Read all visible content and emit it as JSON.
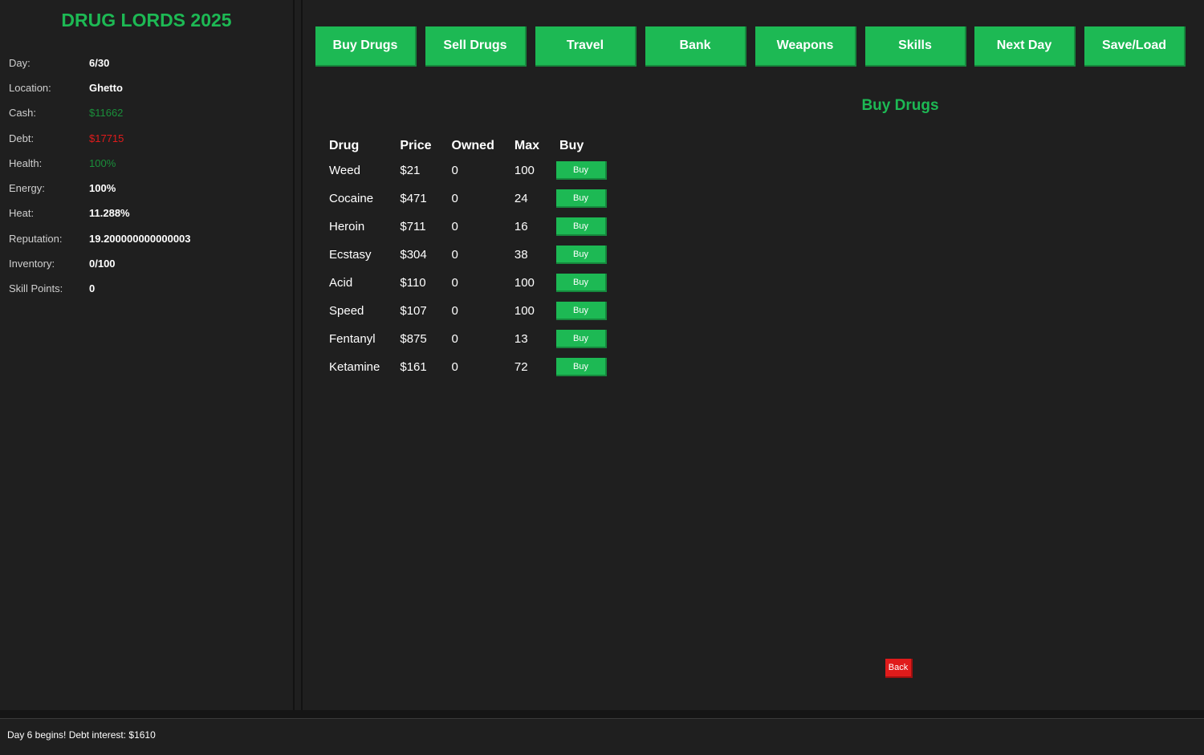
{
  "app": {
    "title": "DRUG LORDS 2025",
    "accent_color": "#1db954",
    "danger_color": "#e01b1b"
  },
  "stats": [
    {
      "label": "Day:",
      "value": "6/30"
    },
    {
      "label": "Location:",
      "value": "Ghetto"
    },
    {
      "label": "Cash:",
      "value": "$11662"
    },
    {
      "label": "Debt:",
      "value": "$17715"
    },
    {
      "label": "Health:",
      "value": "100%"
    },
    {
      "label": "Energy:",
      "value": "100%"
    },
    {
      "label": "Heat:",
      "value": "11.288%"
    },
    {
      "label": "Reputation:",
      "value": "19.200000000000003"
    },
    {
      "label": "Inventory:",
      "value": "0/100"
    },
    {
      "label": "Skill Points:",
      "value": "0"
    }
  ],
  "nav": {
    "buttons": [
      "Buy Drugs",
      "Sell Drugs",
      "Travel",
      "Bank",
      "Weapons",
      "Skills",
      "Next Day",
      "Save/Load"
    ]
  },
  "section": {
    "title": "Buy Drugs"
  },
  "table": {
    "headers": [
      "Drug",
      "Price",
      "Owned",
      "Max",
      "Buy"
    ],
    "rows": [
      {
        "drug": "Weed",
        "price": "$21",
        "owned": "0",
        "max": "100",
        "action": "Buy"
      },
      {
        "drug": "Cocaine",
        "price": "$471",
        "owned": "0",
        "max": "24",
        "action": "Buy"
      },
      {
        "drug": "Heroin",
        "price": "$711",
        "owned": "0",
        "max": "16",
        "action": "Buy"
      },
      {
        "drug": "Ecstasy",
        "price": "$304",
        "owned": "0",
        "max": "38",
        "action": "Buy"
      },
      {
        "drug": "Acid",
        "price": "$110",
        "owned": "0",
        "max": "100",
        "action": "Buy"
      },
      {
        "drug": "Speed",
        "price": "$107",
        "owned": "0",
        "max": "100",
        "action": "Buy"
      },
      {
        "drug": "Fentanyl",
        "price": "$875",
        "owned": "0",
        "max": "13",
        "action": "Buy"
      },
      {
        "drug": "Ketamine",
        "price": "$161",
        "owned": "0",
        "max": "72",
        "action": "Buy"
      }
    ]
  },
  "back_label": "Back",
  "log": {
    "message": "Day 6 begins! Debt interest: $1610"
  }
}
